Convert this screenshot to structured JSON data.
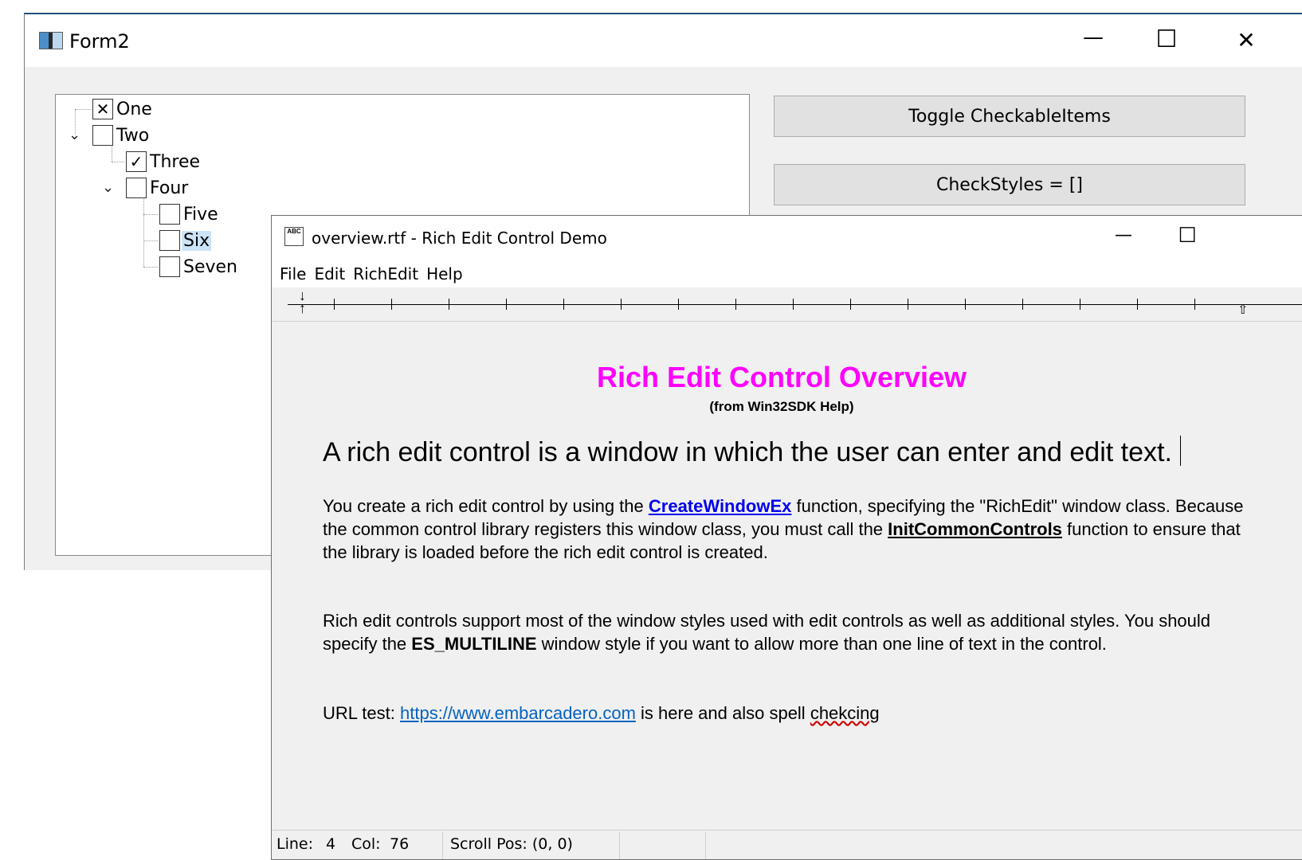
{
  "form2": {
    "title": "Form2",
    "caption_buttons": {
      "minimize": "—",
      "maximize": "☐",
      "close": "✕"
    },
    "tree": [
      {
        "label": "One",
        "check": "✕"
      },
      {
        "label": "Two",
        "check": ""
      },
      {
        "label": "Three",
        "check": "✓"
      },
      {
        "label": "Four",
        "check": ""
      },
      {
        "label": "Five",
        "check": ""
      },
      {
        "label": "Six",
        "check": "",
        "selected": true
      },
      {
        "label": "Seven",
        "check": ""
      }
    ],
    "buttons": {
      "toggle": "Toggle CheckableItems",
      "checkstyles": "CheckStyles = []"
    }
  },
  "rich": {
    "title": "overview.rtf - Rich Edit Control Demo",
    "icon_text": "ABC",
    "caption_buttons": {
      "minimize": "—",
      "maximize": "☐"
    },
    "menu": [
      "File",
      "Edit",
      "RichEdit",
      "Help"
    ],
    "doc": {
      "title": "Rich Edit Control Overview",
      "subtitle": "(from Win32SDK Help)",
      "lead": "A rich edit control is a window in which the user can enter and edit text.",
      "p1_a": "You create a rich edit control by using the ",
      "p1_link": "CreateWindowEx",
      "p1_b": " function, specifying the \"RichEdit\" window class. Because the common control library registers this window class, you must call the ",
      "p1_link2": "InitCommonControls",
      "p1_c": " function to ensure that the library is loaded before the rich edit control is created.",
      "p2_a": "Rich edit controls support most of the window styles used with edit controls as well as additional styles. You should specify the ",
      "p2_bold": "ES_MULTILINE",
      "p2_b": " window style if you want to allow more than one line of text in the control.",
      "p3_a": "URL test: ",
      "p3_url": "https://www.embarcadero.com",
      "p3_b": " is here and also spell ",
      "p3_misspelled": "chekcing"
    },
    "status": {
      "line_label": "Line:",
      "line": "4",
      "col_label": "Col:",
      "col": "76",
      "scroll": "Scroll Pos: (0, 0)"
    }
  }
}
